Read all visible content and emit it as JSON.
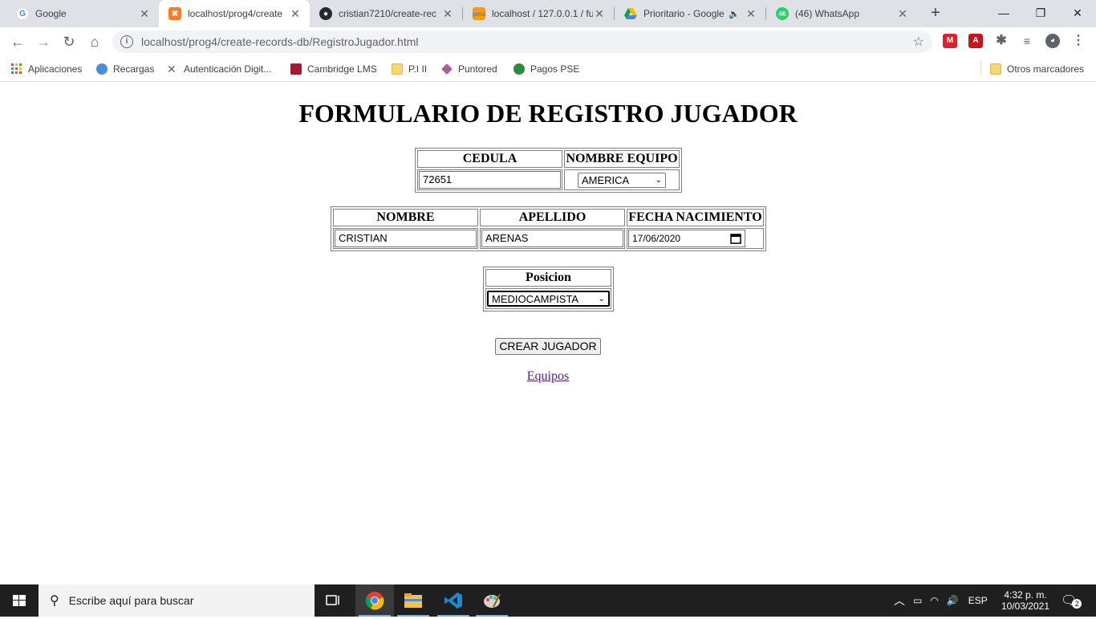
{
  "tabs": [
    {
      "label": "Google",
      "icon": "google-icon",
      "active": false
    },
    {
      "label": "localhost/prog4/create",
      "icon": "xampp-icon",
      "active": true
    },
    {
      "label": "cristian7210/create-rec",
      "icon": "github-icon",
      "active": false
    },
    {
      "label": "localhost / 127.0.0.1 / fu",
      "icon": "phpmyadmin-icon",
      "active": false
    },
    {
      "label": "Prioritario - Google",
      "icon": "drive-icon",
      "active": false
    },
    {
      "label": "(46) WhatsApp",
      "icon": "whatsapp-icon",
      "active": false
    }
  ],
  "whatsapp_badge": "46",
  "window": {
    "minimize": "—",
    "restore": "❐",
    "close": "✕"
  },
  "address": {
    "url": "localhost/prog4/create-records-db/RegistroJugador.html"
  },
  "bookmarks": [
    {
      "label": "Aplicaciones"
    },
    {
      "label": "Recargas"
    },
    {
      "label": "Autenticación Digit..."
    },
    {
      "label": "Cambridge LMS"
    },
    {
      "label": "P.I II"
    },
    {
      "label": "Puntored"
    },
    {
      "label": "Pagos PSE"
    }
  ],
  "other_bookmarks": "Otros marcadores",
  "form": {
    "title": "FORMULARIO DE REGISTRO JUGADOR",
    "cedula_label": "CEDULA",
    "cedula_value": "72651",
    "equipo_label": "NOMBRE EQUIPO",
    "equipo_value": "AMERICA",
    "nombre_label": "NOMBRE",
    "nombre_value": "CRISTIAN",
    "apellido_label": "APELLIDO",
    "apellido_value": "ARENAS",
    "fecha_label": "FECHA NACIMIENTO",
    "fecha_value": "17/06/2020",
    "posicion_label": "Posicion",
    "posicion_value": "MEDIOCAMPISTA",
    "submit_label": "CREAR JUGADOR",
    "link_label": "Equipos"
  },
  "taskbar": {
    "search_placeholder": "Escribe aquí para buscar",
    "lang": "ESP",
    "time": "4:32 p. m.",
    "date": "10/03/2021",
    "notifications": "2"
  },
  "colors": {
    "link_visited": "#551a8b",
    "tab_strip": "#dee1e6",
    "taskbar": "#1f1f1f"
  }
}
